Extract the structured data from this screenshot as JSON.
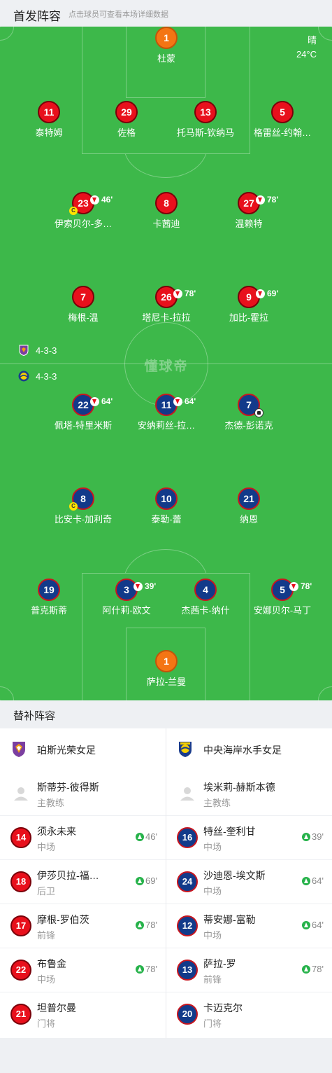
{
  "header": {
    "title": "首发阵容",
    "subtitle": "点击球员可查看本场详细数据"
  },
  "weather": {
    "condition": "晴",
    "temperature": "24°C"
  },
  "watermark": "懂球帝",
  "home": {
    "name": "珀斯光荣女足",
    "formation": "4-3-3",
    "colors": {
      "shirt": "#e8101c",
      "border": "#7a0009"
    },
    "goalkeeper": {
      "number": "1",
      "name": "杜蒙"
    },
    "defenders": [
      {
        "number": "11",
        "name": "泰特姆"
      },
      {
        "number": "29",
        "name": "佐格"
      },
      {
        "number": "13",
        "name": "托马斯-钦纳马"
      },
      {
        "number": "5",
        "name": "格雷丝-约翰…"
      }
    ],
    "midfielders": [
      {
        "number": "23",
        "name": "伊索贝尔-多…",
        "sub_minute": "46'",
        "captain": "C"
      },
      {
        "number": "8",
        "name": "卡茜迪"
      },
      {
        "number": "27",
        "name": "温赖特",
        "sub_minute": "78'"
      }
    ],
    "forwards": [
      {
        "number": "7",
        "name": "梅根-温"
      },
      {
        "number": "26",
        "name": "塔尼卡-拉拉",
        "sub_minute": "78'"
      },
      {
        "number": "9",
        "name": "加比-霍拉",
        "sub_minute": "69'"
      }
    ]
  },
  "away": {
    "name": "中央海岸水手女足",
    "formation": "4-3-3",
    "colors": {
      "shirt": "#123a8a",
      "border": "#c8161f"
    },
    "forwards": [
      {
        "number": "22",
        "name": "佩塔-特里米斯",
        "sub_minute": "64'"
      },
      {
        "number": "11",
        "name": "安纳莉丝-拉…",
        "sub_minute": "64'"
      },
      {
        "number": "7",
        "name": "杰德-彭诺克",
        "goal": "ball-icon"
      }
    ],
    "midfielders": [
      {
        "number": "8",
        "name": "比安卡-加利奇",
        "captain": "C"
      },
      {
        "number": "10",
        "name": "泰勒-蕾"
      },
      {
        "number": "21",
        "name": "纳恩"
      }
    ],
    "defenders": [
      {
        "number": "19",
        "name": "普克斯蒂"
      },
      {
        "number": "3",
        "name": "阿什莉-欧文",
        "sub_minute": "39'"
      },
      {
        "number": "4",
        "name": "杰茜卡-纳什"
      },
      {
        "number": "5",
        "name": "安娜贝尔-马丁",
        "sub_minute": "78'"
      }
    ],
    "goalkeeper": {
      "number": "1",
      "name": "萨拉-兰曼"
    }
  },
  "subs_header": "替补阵容",
  "subs": {
    "home": {
      "team": "珀斯光荣女足",
      "coach": {
        "name": "斯蒂芬-彼得斯",
        "role": "主教练",
        "icon": "person-icon"
      },
      "players": [
        {
          "number": "14",
          "name": "须永未来",
          "position": "中场",
          "minute": "46'"
        },
        {
          "number": "18",
          "name": "伊莎贝拉-福…",
          "position": "后卫",
          "minute": "69'"
        },
        {
          "number": "17",
          "name": "摩根-罗伯茨",
          "position": "前锋",
          "minute": "78'"
        },
        {
          "number": "22",
          "name": "布鲁金",
          "position": "中场",
          "minute": "78'"
        },
        {
          "number": "21",
          "name": "坦普尔曼",
          "position": "门将"
        }
      ]
    },
    "away": {
      "team": "中央海岸水手女足",
      "coach": {
        "name": "埃米莉-赫斯本德",
        "role": "主教练",
        "icon": "person-icon"
      },
      "players": [
        {
          "number": "16",
          "name": "特丝-奎利甘",
          "position": "中场",
          "minute": "39'"
        },
        {
          "number": "24",
          "name": "沙迪恩-埃文斯",
          "position": "中场",
          "minute": "64'"
        },
        {
          "number": "12",
          "name": "蒂安娜-富勒",
          "position": "中场",
          "minute": "64'"
        },
        {
          "number": "13",
          "name": "萨拉-罗",
          "position": "前锋",
          "minute": "78'"
        },
        {
          "number": "20",
          "name": "卡迈克尔",
          "position": "门将"
        }
      ]
    }
  }
}
